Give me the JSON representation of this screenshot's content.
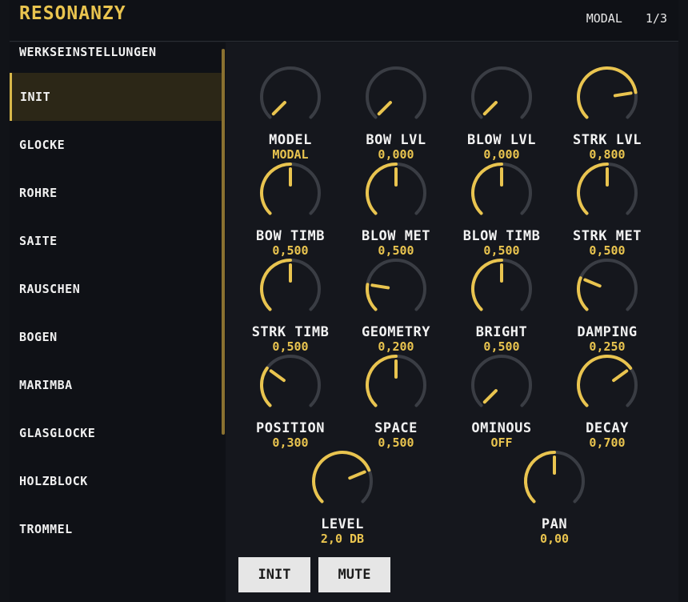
{
  "header": {
    "title": "RESONANZY",
    "mode": "MODAL",
    "page": "1/3"
  },
  "colors": {
    "accent": "#e9c44f",
    "track": "#3a3d44",
    "bg": "#14161c"
  },
  "sidebar": {
    "items": [
      {
        "label": "WERKSEINSTELLUNGEN",
        "active": false
      },
      {
        "label": "INIT",
        "active": true
      },
      {
        "label": "GLOCKE",
        "active": false
      },
      {
        "label": "ROHRE",
        "active": false
      },
      {
        "label": "SAITE",
        "active": false
      },
      {
        "label": "RAUSCHEN",
        "active": false
      },
      {
        "label": "BOGEN",
        "active": false
      },
      {
        "label": "MARIMBA",
        "active": false
      },
      {
        "label": "GLASGLOCKE",
        "active": false
      },
      {
        "label": "HOLZBLOCK",
        "active": false
      },
      {
        "label": "TROMMEL",
        "active": false
      }
    ]
  },
  "knobs": [
    {
      "label": "MODEL",
      "value": "MODAL",
      "level": 0.0
    },
    {
      "label": "BOW LVL",
      "value": "0,000",
      "level": 0.0
    },
    {
      "label": "BLOW LVL",
      "value": "0,000",
      "level": 0.0
    },
    {
      "label": "STRK LVL",
      "value": "0,800",
      "level": 0.8
    },
    {
      "label": "BOW TIMB",
      "value": "0,500",
      "level": 0.5
    },
    {
      "label": "BLOW MET",
      "value": "0,500",
      "level": 0.5
    },
    {
      "label": "BLOW TIMB",
      "value": "0,500",
      "level": 0.5
    },
    {
      "label": "STRK MET",
      "value": "0,500",
      "level": 0.5
    },
    {
      "label": "STRK TIMB",
      "value": "0,500",
      "level": 0.5
    },
    {
      "label": "GEOMETRY",
      "value": "0,200",
      "level": 0.2
    },
    {
      "label": "BRIGHT",
      "value": "0,500",
      "level": 0.5
    },
    {
      "label": "DAMPING",
      "value": "0,250",
      "level": 0.25
    },
    {
      "label": "POSITION",
      "value": "0,300",
      "level": 0.3
    },
    {
      "label": "SPACE",
      "value": "0,500",
      "level": 0.5
    },
    {
      "label": "OMINOUS",
      "value": "OFF",
      "level": 0.0
    },
    {
      "label": "DECAY",
      "value": "0,700",
      "level": 0.7
    },
    {
      "label": "LEVEL",
      "value": "2,0 DB",
      "level": 0.75
    },
    {
      "label": "PAN",
      "value": "0,00",
      "level": 0.5
    }
  ],
  "buttons": {
    "init": "INIT",
    "mute": "MUTE"
  }
}
